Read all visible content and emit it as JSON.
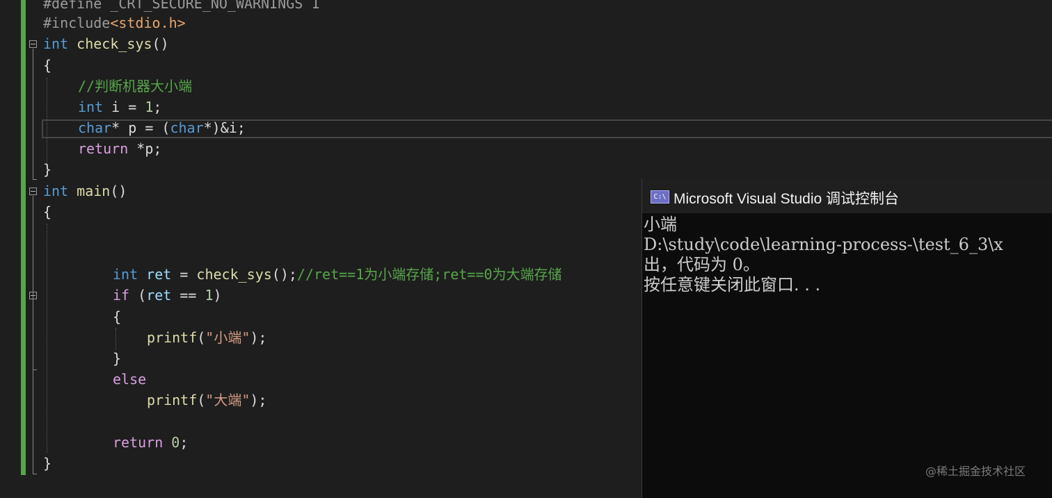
{
  "editor": {
    "lines": {
      "l0": {
        "pp": "#define ",
        "name": "_CRT_SECURE_NO_WARNINGS",
        "val": " 1"
      },
      "l1": {
        "pp": "#include",
        "path": "<stdio.h>"
      },
      "l2": {
        "kw": "int",
        "fn": "check_sys",
        "rest": "()"
      },
      "l3": {
        "text": "{"
      },
      "l4": {
        "comment": "//判断机器大小端"
      },
      "l5": {
        "kw": "int",
        "mid": " i = ",
        "num": "1",
        "end": ";"
      },
      "l6": {
        "kw1": "char",
        "mid1": "* p = (",
        "kw2": "char",
        "mid2": "*)&i;"
      },
      "l7": {
        "ctl": "return",
        "rest": " *p;"
      },
      "l8": {
        "text": "}"
      },
      "l9": {
        "kw": "int",
        "fn": "main",
        "rest": "()"
      },
      "l10": {
        "text": "{"
      },
      "l13": {
        "kw": "int",
        "var": " ret",
        "mid": " = ",
        "fn": "check_sys",
        "end": "();",
        "comment": "//ret==1为小端存储;ret==0为大端存储"
      },
      "l14": {
        "ctl": "if",
        "open": " (",
        "var": "ret",
        "mid": " == ",
        "num": "1",
        "close": ")"
      },
      "l15": {
        "text": "{"
      },
      "l16": {
        "fn": "printf",
        "open": "(",
        "str": "\"小端\"",
        "close": ");"
      },
      "l17": {
        "text": "}"
      },
      "l18": {
        "ctl": "else"
      },
      "l19": {
        "fn": "printf",
        "open": "(",
        "str": "\"大端\"",
        "close": ");"
      },
      "l21": {
        "ctl": "return",
        "sp": " ",
        "num": "0",
        "end": ";"
      },
      "l22": {
        "text": "}"
      }
    }
  },
  "console": {
    "icon_text": "C:\\",
    "title": "Microsoft Visual Studio 调试控制台",
    "lines": [
      "小端",
      "D:\\study\\code\\learning-process-\\test_6_3\\x",
      "出，代码为 0。",
      "按任意键关闭此窗口. . ."
    ]
  },
  "watermark": "@稀土掘金技术社区",
  "colors": {
    "background": "#1e1e1e",
    "keyword": "#569cd6",
    "comment": "#57a64a",
    "string": "#d69d85",
    "function": "#dcdcaa",
    "control": "#d8a0df",
    "console_bg": "#0c0c0c"
  },
  "icons": {
    "fold": "collapse-box-icon",
    "console": "console-app-icon"
  }
}
